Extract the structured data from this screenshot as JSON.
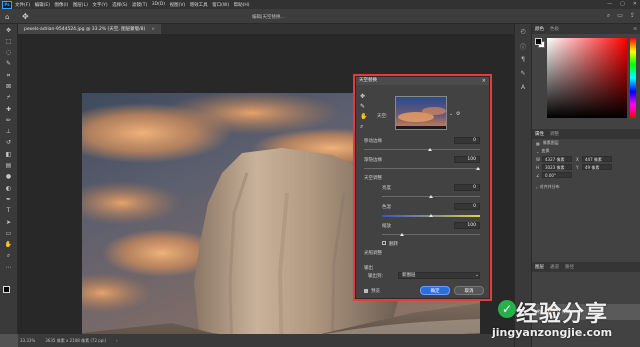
{
  "app": {
    "logo": "Ps",
    "window_title": "编辑|天空替换..."
  },
  "menu": [
    "文件(F)",
    "编辑(E)",
    "图像(I)",
    "图层(L)",
    "文字(Y)",
    "选择(S)",
    "滤镜(T)",
    "3D(D)",
    "视图(V)",
    "增效工具",
    "窗口(W)",
    "帮助(H)"
  ],
  "window_controls": [
    "—",
    "▢",
    "✕"
  ],
  "document": {
    "tab_label": "pexels-adrian-9544524.jpg @ 33.2% (天空, 图层蒙版/8)",
    "tab_close": "×"
  },
  "status": {
    "zoom": "33.33%",
    "doc_info": "3635 像素 x 2108 像素 (72 ppi)",
    "arrow": "›"
  },
  "dialog": {
    "title": "天空替换",
    "close": "×",
    "sky_label": "天空:",
    "shift_edge_label": "移动边缘",
    "shift_edge_value": "0",
    "fade_edge_label": "渐隐边缘",
    "fade_edge_value": "100",
    "sky_adjust_label": "天空调整",
    "brightness_label": "亮度",
    "brightness_value": "0",
    "temperature_label": "色温",
    "temperature_value": "0",
    "scale_label": "缩放",
    "scale_value": "100",
    "flip_label": "翻转",
    "lighting_label": "光照调整",
    "output_label": "输出",
    "output_to_label": "输出到:",
    "output_to_value": "新图层",
    "preview_label": "预览",
    "ok_label": "确定",
    "cancel_label": "取消"
  },
  "panels": {
    "color_tabs": [
      "颜色",
      "色板"
    ],
    "properties_tabs": [
      "属性",
      "调整"
    ],
    "properties_subtitle": "像素图层",
    "transform_label": "变换",
    "w_label": "W",
    "w_value": "4327 像素",
    "h_label": "H",
    "h_value": "3023 像素",
    "x_label": "X",
    "x_value": "447 像素",
    "y_label": "Y",
    "y_value": "49 像素",
    "angle_value": "0.00°",
    "align_label": "对齐并分布",
    "layers_tabs": [
      "图层",
      "通道",
      "路径"
    ],
    "layer_name": "背景"
  },
  "watermark": {
    "text_cn": "经验分享",
    "url": "jingyanzongjie.com",
    "mark": "✓"
  },
  "colors": {
    "accent": "#2c6ee0",
    "highlight": "#e23c3c",
    "panel_bg": "#424242"
  }
}
